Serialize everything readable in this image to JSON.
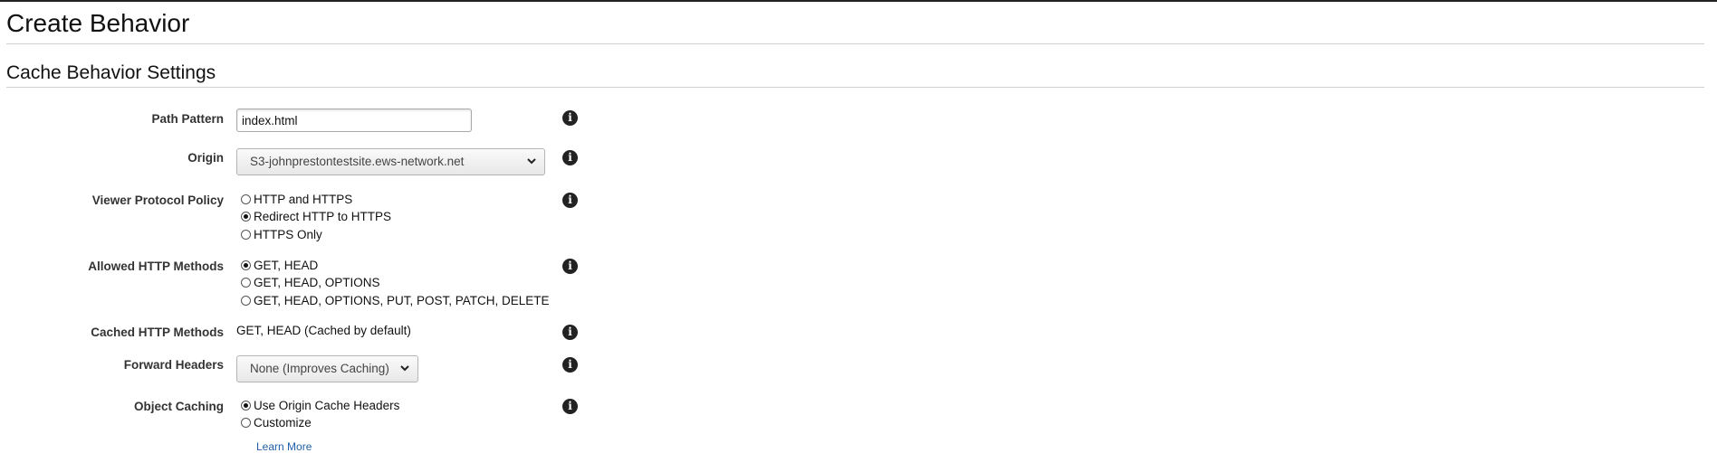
{
  "page": {
    "title": "Create Behavior",
    "section_title": "Cache Behavior Settings"
  },
  "fields": {
    "path_pattern": {
      "label": "Path Pattern",
      "value": "index.html"
    },
    "origin": {
      "label": "Origin",
      "value": "S3-johnprestontestsite.ews-network.net"
    },
    "viewer_protocol_policy": {
      "label": "Viewer Protocol Policy",
      "options": [
        "HTTP and HTTPS",
        "Redirect HTTP to HTTPS",
        "HTTPS Only"
      ],
      "selected": "Redirect HTTP to HTTPS"
    },
    "allowed_http_methods": {
      "label": "Allowed HTTP Methods",
      "options": [
        "GET, HEAD",
        "GET, HEAD, OPTIONS",
        "GET, HEAD, OPTIONS, PUT, POST, PATCH, DELETE"
      ],
      "selected": "GET, HEAD"
    },
    "cached_http_methods": {
      "label": "Cached HTTP Methods",
      "value": "GET, HEAD (Cached by default)"
    },
    "forward_headers": {
      "label": "Forward Headers",
      "value": "None (Improves Caching)"
    },
    "object_caching": {
      "label": "Object Caching",
      "options": [
        "Use Origin Cache Headers",
        "Customize"
      ],
      "selected": "Use Origin Cache Headers",
      "learn_more": "Learn More"
    }
  },
  "icons": {
    "info": "info-icon",
    "dropdown": "chevron-down-icon"
  },
  "colors": {
    "link": "#1f5fa8",
    "text": "#111111",
    "label": "#333333"
  }
}
